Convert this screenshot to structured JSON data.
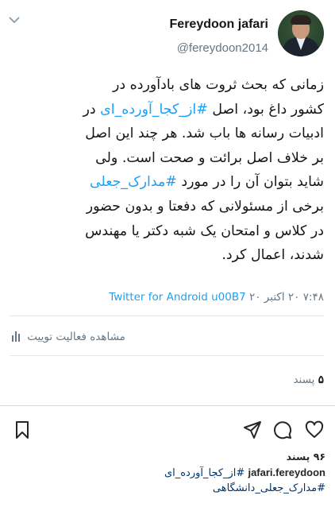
{
  "tweet": {
    "author_name": "Fereydoon jafari",
    "author_handle": "@fereydoon2014",
    "text_line1": "زمانی که بحث ثروت های بادآورده در",
    "text_line2a": "کشور داغ بود، اصل ",
    "hashtag1": "#از_کجا_آورده_ای",
    "text_line2b": " در",
    "text_line3": "ادبیات رسانه ها باب شد. هر چند این اصل",
    "text_line4": "بر خلاف اصل برائت و صحت است. ولی",
    "text_line5a": "شاید بتوان آن را در مورد ",
    "hashtag2": "#مدارک_جعلی",
    "text_line6": "برخی از مسئولانی که دفعتا و بدون حضور",
    "text_line7": "در کلاس و امتحان یک شبه دکتر یا مهندس",
    "text_line8": "شدند، اعمال کرد.",
    "timestamp": "۷:۴۸ ۲۰ اکتبر ۲۰",
    "source": "Twitter for Android u00B7",
    "activity_label": "مشاهده فعالیت توییت",
    "likes_count": "۵",
    "likes_label": "پسند"
  },
  "instagram": {
    "likes_count": "۹۶",
    "likes_label": "پسند",
    "username": "jafari.fereydoon",
    "caption_tag1": "#از_کجا_آورده_ای",
    "caption_tag2": "#مدارک_جعلی_دانشگاهی"
  },
  "colors": {
    "accent": "#1da1f2",
    "muted": "#657786"
  }
}
